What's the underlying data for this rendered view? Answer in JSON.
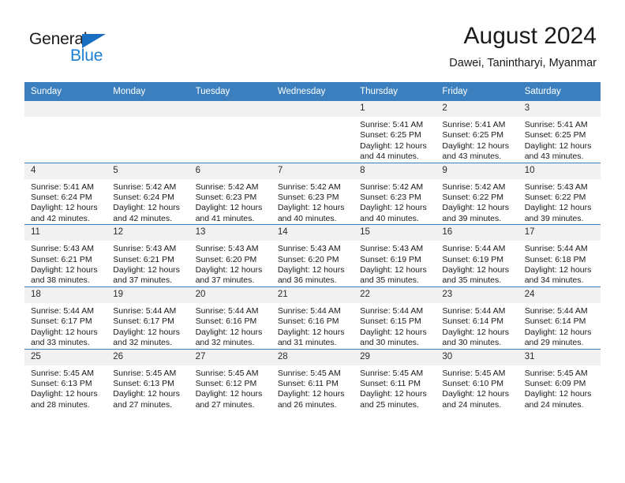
{
  "brand": {
    "name_top": "General",
    "name_bottom": "Blue",
    "triangle_color": "#1b6fc0",
    "blue_color": "#1b7fd4"
  },
  "header": {
    "title": "August 2024",
    "subtitle": "Dawei, Tanintharyi, Myanmar"
  },
  "theme": {
    "header_row_bg": "#3b7fbe",
    "header_row_text": "#ffffff",
    "daynum_bg": "#f1f1f1",
    "cell_border": "#3b7fbe"
  },
  "weekday_headers": [
    "Sunday",
    "Monday",
    "Tuesday",
    "Wednesday",
    "Thursday",
    "Friday",
    "Saturday"
  ],
  "weeks": [
    [
      {
        "day": "",
        "sunrise": "",
        "sunset": "",
        "daylight_1": "",
        "daylight_2": "",
        "empty": true
      },
      {
        "day": "",
        "sunrise": "",
        "sunset": "",
        "daylight_1": "",
        "daylight_2": "",
        "empty": true
      },
      {
        "day": "",
        "sunrise": "",
        "sunset": "",
        "daylight_1": "",
        "daylight_2": "",
        "empty": true
      },
      {
        "day": "",
        "sunrise": "",
        "sunset": "",
        "daylight_1": "",
        "daylight_2": "",
        "empty": true
      },
      {
        "day": "1",
        "sunrise": "Sunrise: 5:41 AM",
        "sunset": "Sunset: 6:25 PM",
        "daylight_1": "Daylight: 12 hours",
        "daylight_2": "and 44 minutes."
      },
      {
        "day": "2",
        "sunrise": "Sunrise: 5:41 AM",
        "sunset": "Sunset: 6:25 PM",
        "daylight_1": "Daylight: 12 hours",
        "daylight_2": "and 43 minutes."
      },
      {
        "day": "3",
        "sunrise": "Sunrise: 5:41 AM",
        "sunset": "Sunset: 6:25 PM",
        "daylight_1": "Daylight: 12 hours",
        "daylight_2": "and 43 minutes."
      }
    ],
    [
      {
        "day": "4",
        "sunrise": "Sunrise: 5:41 AM",
        "sunset": "Sunset: 6:24 PM",
        "daylight_1": "Daylight: 12 hours",
        "daylight_2": "and 42 minutes."
      },
      {
        "day": "5",
        "sunrise": "Sunrise: 5:42 AM",
        "sunset": "Sunset: 6:24 PM",
        "daylight_1": "Daylight: 12 hours",
        "daylight_2": "and 42 minutes."
      },
      {
        "day": "6",
        "sunrise": "Sunrise: 5:42 AM",
        "sunset": "Sunset: 6:23 PM",
        "daylight_1": "Daylight: 12 hours",
        "daylight_2": "and 41 minutes."
      },
      {
        "day": "7",
        "sunrise": "Sunrise: 5:42 AM",
        "sunset": "Sunset: 6:23 PM",
        "daylight_1": "Daylight: 12 hours",
        "daylight_2": "and 40 minutes."
      },
      {
        "day": "8",
        "sunrise": "Sunrise: 5:42 AM",
        "sunset": "Sunset: 6:23 PM",
        "daylight_1": "Daylight: 12 hours",
        "daylight_2": "and 40 minutes."
      },
      {
        "day": "9",
        "sunrise": "Sunrise: 5:42 AM",
        "sunset": "Sunset: 6:22 PM",
        "daylight_1": "Daylight: 12 hours",
        "daylight_2": "and 39 minutes."
      },
      {
        "day": "10",
        "sunrise": "Sunrise: 5:43 AM",
        "sunset": "Sunset: 6:22 PM",
        "daylight_1": "Daylight: 12 hours",
        "daylight_2": "and 39 minutes."
      }
    ],
    [
      {
        "day": "11",
        "sunrise": "Sunrise: 5:43 AM",
        "sunset": "Sunset: 6:21 PM",
        "daylight_1": "Daylight: 12 hours",
        "daylight_2": "and 38 minutes."
      },
      {
        "day": "12",
        "sunrise": "Sunrise: 5:43 AM",
        "sunset": "Sunset: 6:21 PM",
        "daylight_1": "Daylight: 12 hours",
        "daylight_2": "and 37 minutes."
      },
      {
        "day": "13",
        "sunrise": "Sunrise: 5:43 AM",
        "sunset": "Sunset: 6:20 PM",
        "daylight_1": "Daylight: 12 hours",
        "daylight_2": "and 37 minutes."
      },
      {
        "day": "14",
        "sunrise": "Sunrise: 5:43 AM",
        "sunset": "Sunset: 6:20 PM",
        "daylight_1": "Daylight: 12 hours",
        "daylight_2": "and 36 minutes."
      },
      {
        "day": "15",
        "sunrise": "Sunrise: 5:43 AM",
        "sunset": "Sunset: 6:19 PM",
        "daylight_1": "Daylight: 12 hours",
        "daylight_2": "and 35 minutes."
      },
      {
        "day": "16",
        "sunrise": "Sunrise: 5:44 AM",
        "sunset": "Sunset: 6:19 PM",
        "daylight_1": "Daylight: 12 hours",
        "daylight_2": "and 35 minutes."
      },
      {
        "day": "17",
        "sunrise": "Sunrise: 5:44 AM",
        "sunset": "Sunset: 6:18 PM",
        "daylight_1": "Daylight: 12 hours",
        "daylight_2": "and 34 minutes."
      }
    ],
    [
      {
        "day": "18",
        "sunrise": "Sunrise: 5:44 AM",
        "sunset": "Sunset: 6:17 PM",
        "daylight_1": "Daylight: 12 hours",
        "daylight_2": "and 33 minutes."
      },
      {
        "day": "19",
        "sunrise": "Sunrise: 5:44 AM",
        "sunset": "Sunset: 6:17 PM",
        "daylight_1": "Daylight: 12 hours",
        "daylight_2": "and 32 minutes."
      },
      {
        "day": "20",
        "sunrise": "Sunrise: 5:44 AM",
        "sunset": "Sunset: 6:16 PM",
        "daylight_1": "Daylight: 12 hours",
        "daylight_2": "and 32 minutes."
      },
      {
        "day": "21",
        "sunrise": "Sunrise: 5:44 AM",
        "sunset": "Sunset: 6:16 PM",
        "daylight_1": "Daylight: 12 hours",
        "daylight_2": "and 31 minutes."
      },
      {
        "day": "22",
        "sunrise": "Sunrise: 5:44 AM",
        "sunset": "Sunset: 6:15 PM",
        "daylight_1": "Daylight: 12 hours",
        "daylight_2": "and 30 minutes."
      },
      {
        "day": "23",
        "sunrise": "Sunrise: 5:44 AM",
        "sunset": "Sunset: 6:14 PM",
        "daylight_1": "Daylight: 12 hours",
        "daylight_2": "and 30 minutes."
      },
      {
        "day": "24",
        "sunrise": "Sunrise: 5:44 AM",
        "sunset": "Sunset: 6:14 PM",
        "daylight_1": "Daylight: 12 hours",
        "daylight_2": "and 29 minutes."
      }
    ],
    [
      {
        "day": "25",
        "sunrise": "Sunrise: 5:45 AM",
        "sunset": "Sunset: 6:13 PM",
        "daylight_1": "Daylight: 12 hours",
        "daylight_2": "and 28 minutes."
      },
      {
        "day": "26",
        "sunrise": "Sunrise: 5:45 AM",
        "sunset": "Sunset: 6:13 PM",
        "daylight_1": "Daylight: 12 hours",
        "daylight_2": "and 27 minutes."
      },
      {
        "day": "27",
        "sunrise": "Sunrise: 5:45 AM",
        "sunset": "Sunset: 6:12 PM",
        "daylight_1": "Daylight: 12 hours",
        "daylight_2": "and 27 minutes."
      },
      {
        "day": "28",
        "sunrise": "Sunrise: 5:45 AM",
        "sunset": "Sunset: 6:11 PM",
        "daylight_1": "Daylight: 12 hours",
        "daylight_2": "and 26 minutes."
      },
      {
        "day": "29",
        "sunrise": "Sunrise: 5:45 AM",
        "sunset": "Sunset: 6:11 PM",
        "daylight_1": "Daylight: 12 hours",
        "daylight_2": "and 25 minutes."
      },
      {
        "day": "30",
        "sunrise": "Sunrise: 5:45 AM",
        "sunset": "Sunset: 6:10 PM",
        "daylight_1": "Daylight: 12 hours",
        "daylight_2": "and 24 minutes."
      },
      {
        "day": "31",
        "sunrise": "Sunrise: 5:45 AM",
        "sunset": "Sunset: 6:09 PM",
        "daylight_1": "Daylight: 12 hours",
        "daylight_2": "and 24 minutes."
      }
    ]
  ]
}
